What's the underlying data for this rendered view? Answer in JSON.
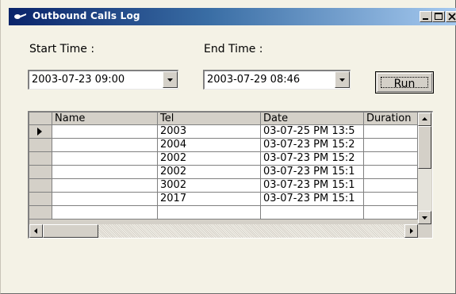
{
  "window": {
    "title": "Outbound Calls Log",
    "controls": [
      "minimize",
      "maximize",
      "close"
    ]
  },
  "filters": {
    "start_label": "Start Time :",
    "start_value": "2003-07-23 09:00",
    "end_label": "End Time :",
    "end_value": "2003-07-29 08:46"
  },
  "run_button": {
    "label": "Run"
  },
  "grid": {
    "columns": [
      "Name",
      "Tel",
      "Date",
      "Duration"
    ],
    "rows": [
      {
        "name": "",
        "tel": "2003",
        "date": "03-07-25 PM 13:5",
        "duration": ""
      },
      {
        "name": "",
        "tel": "2004",
        "date": "03-07-23 PM 15:2",
        "duration": ""
      },
      {
        "name": "",
        "tel": "2002",
        "date": "03-07-23 PM 15:2",
        "duration": ""
      },
      {
        "name": "",
        "tel": "2002",
        "date": "03-07-23 PM 15:1",
        "duration": ""
      },
      {
        "name": "",
        "tel": "3002",
        "date": "03-07-23 PM 15:1",
        "duration": ""
      },
      {
        "name": "",
        "tel": "2017",
        "date": "03-07-23 PM 15:1",
        "duration": ""
      }
    ],
    "current_row_indicator": "triangle-right-icon"
  }
}
